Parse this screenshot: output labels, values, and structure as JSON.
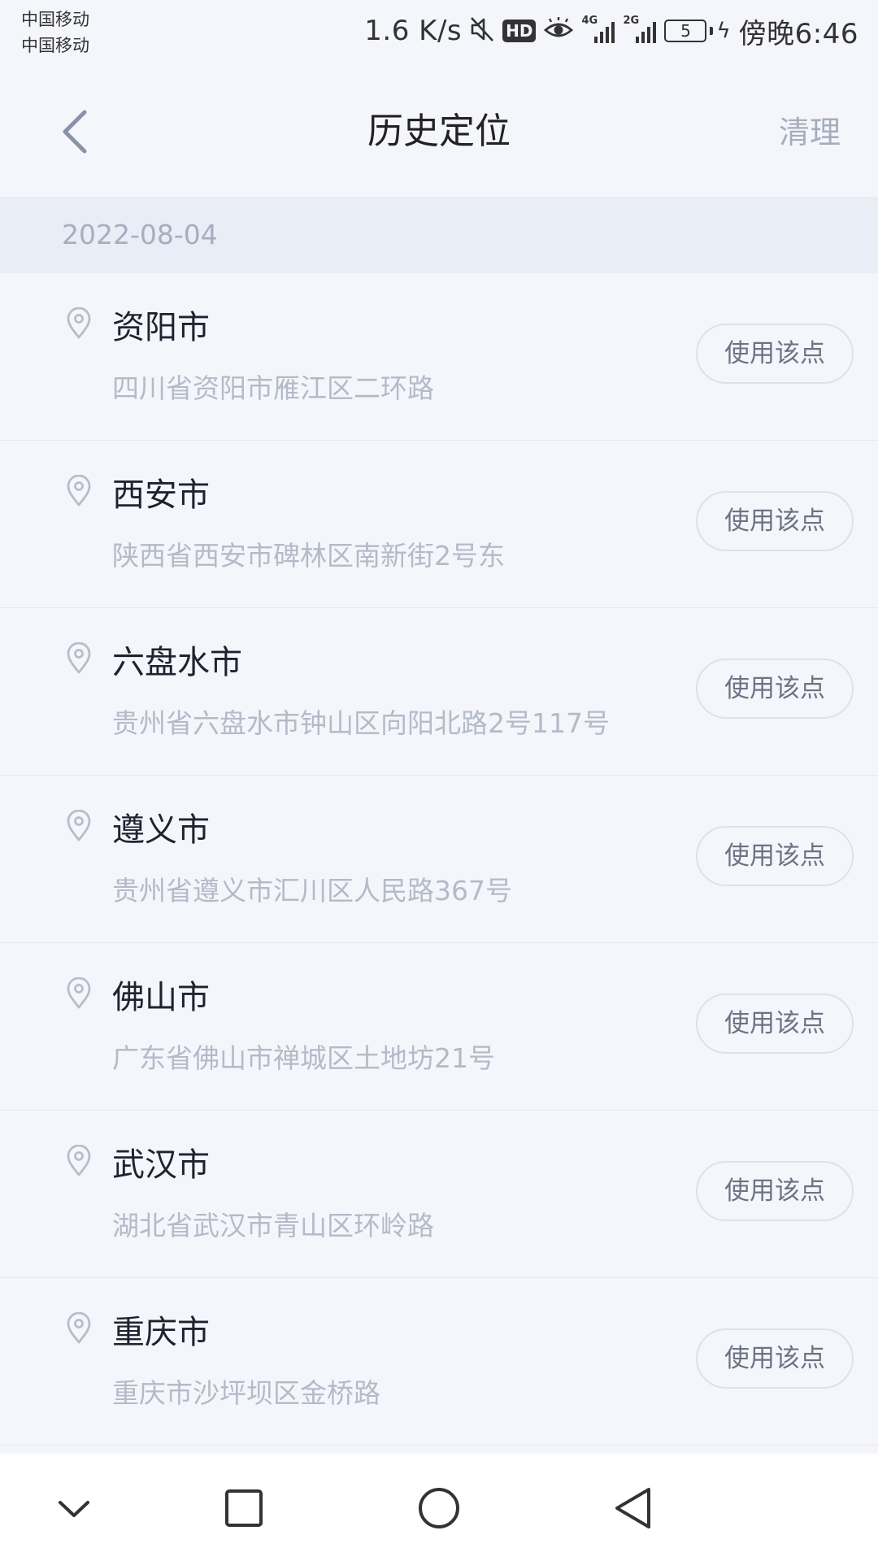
{
  "status_bar": {
    "carrier_1": "中国移动",
    "carrier_2": "中国移动",
    "net_speed": "1.6 K/s",
    "hd_label": "HD",
    "signal_1_tag": "4G",
    "signal_2_tag": "2G",
    "battery_level": "5",
    "time": "傍晚6:46"
  },
  "header": {
    "title": "历史定位",
    "clear_label": "清理"
  },
  "date_group": "2022-08-04",
  "use_button_label": "使用该点",
  "locations": [
    {
      "city": "资阳市",
      "address": "四川省资阳市雁江区二环路"
    },
    {
      "city": "西安市",
      "address": "陕西省西安市碑林区南新街2号东"
    },
    {
      "city": "六盘水市",
      "address": "贵州省六盘水市钟山区向阳北路2号117号"
    },
    {
      "city": "遵义市",
      "address": "贵州省遵义市汇川区人民路367号"
    },
    {
      "city": "佛山市",
      "address": "广东省佛山市禅城区土地坊21号"
    },
    {
      "city": "武汉市",
      "address": "湖北省武汉市青山区环岭路"
    },
    {
      "city": "重庆市",
      "address": "重庆市沙坪坝区金桥路"
    }
  ],
  "colors": {
    "background": "#f4f6fb",
    "date_header_bg": "#e9edf6",
    "muted_text": "#b4bac8",
    "primary_text": "#1f2230"
  }
}
